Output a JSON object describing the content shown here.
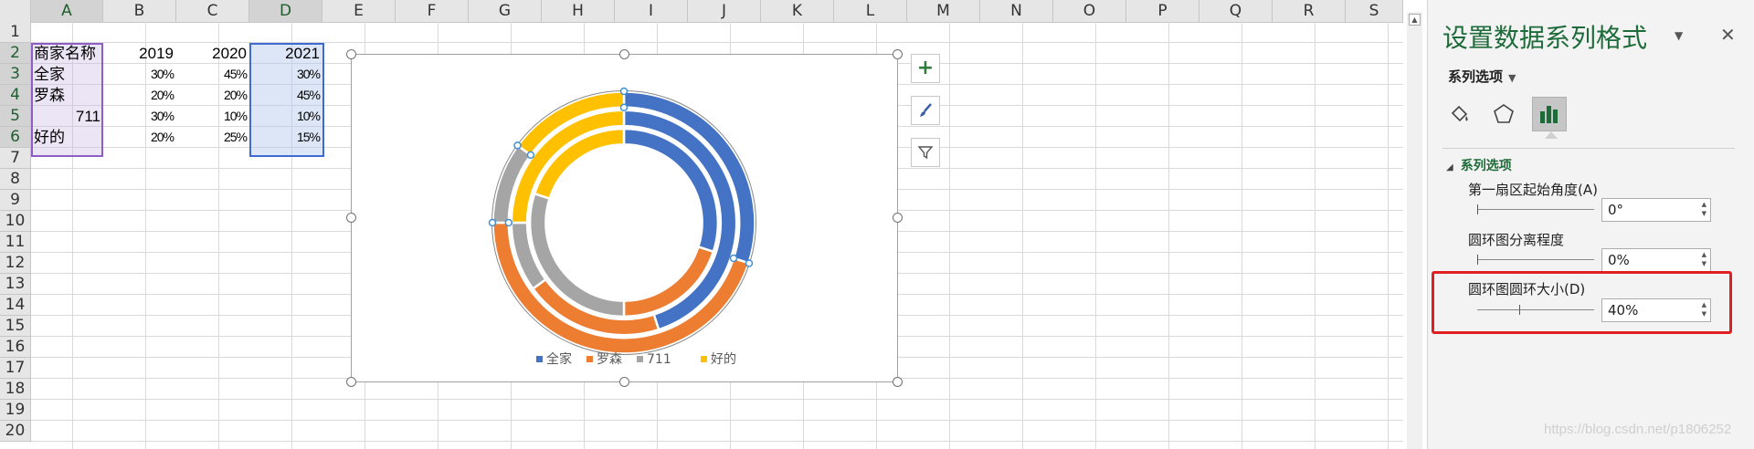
{
  "columns": [
    "A",
    "B",
    "C",
    "D",
    "E",
    "F",
    "G",
    "H",
    "I",
    "J",
    "K",
    "L",
    "M",
    "N",
    "O",
    "P",
    "Q",
    "R",
    "S"
  ],
  "rows": [
    "1",
    "2",
    "3",
    "4",
    "5",
    "6",
    "7",
    "8",
    "9",
    "10",
    "11",
    "12",
    "13",
    "14",
    "15",
    "16",
    "17",
    "18",
    "19",
    "20"
  ],
  "table": {
    "header": [
      "商家名称",
      "2019",
      "2020",
      "2021"
    ],
    "rows": [
      [
        "全家",
        "30%",
        "45%",
        "30%"
      ],
      [
        "罗森",
        "20%",
        "20%",
        "45%"
      ],
      [
        "711",
        "30%",
        "10%",
        "10%"
      ],
      [
        "好的",
        "20%",
        "25%",
        "15%"
      ]
    ]
  },
  "chart_data": {
    "type": "doughnut",
    "categories": [
      "全家",
      "罗森",
      "711",
      "好的"
    ],
    "series": [
      {
        "values": [
          30,
          20,
          30,
          20
        ]
      },
      {
        "values": [
          45,
          20,
          10,
          25
        ]
      },
      {
        "values": [
          30,
          45,
          10,
          15
        ]
      }
    ],
    "colors": [
      "#4472c4",
      "#ed7d31",
      "#a5a5a5",
      "#ffc000"
    ],
    "legend_position": "bottom",
    "first_slice_angle": 0,
    "hole_size_percent": 40
  },
  "chart_side_buttons": [
    {
      "icon": "plus-icon"
    },
    {
      "icon": "brush-icon"
    },
    {
      "icon": "filter-icon"
    }
  ],
  "pane": {
    "title": "设置数据系列格式",
    "series_options_label": "系列选项",
    "tab_icons": [
      "fill-line-icon",
      "effects-pentagon-icon",
      "series-options-bar-icon"
    ],
    "section_title": "系列选项",
    "controls": [
      {
        "label": "第一扇区起始角度(A)",
        "value": "0°",
        "level": 0
      },
      {
        "label": "圆环图分离程度",
        "value": "0%",
        "level": 0
      },
      {
        "label": "圆环图圆环大小(D)",
        "value": "40%",
        "level": 0.4
      }
    ]
  },
  "watermark": "https://blog.csdn.net/p1806252"
}
